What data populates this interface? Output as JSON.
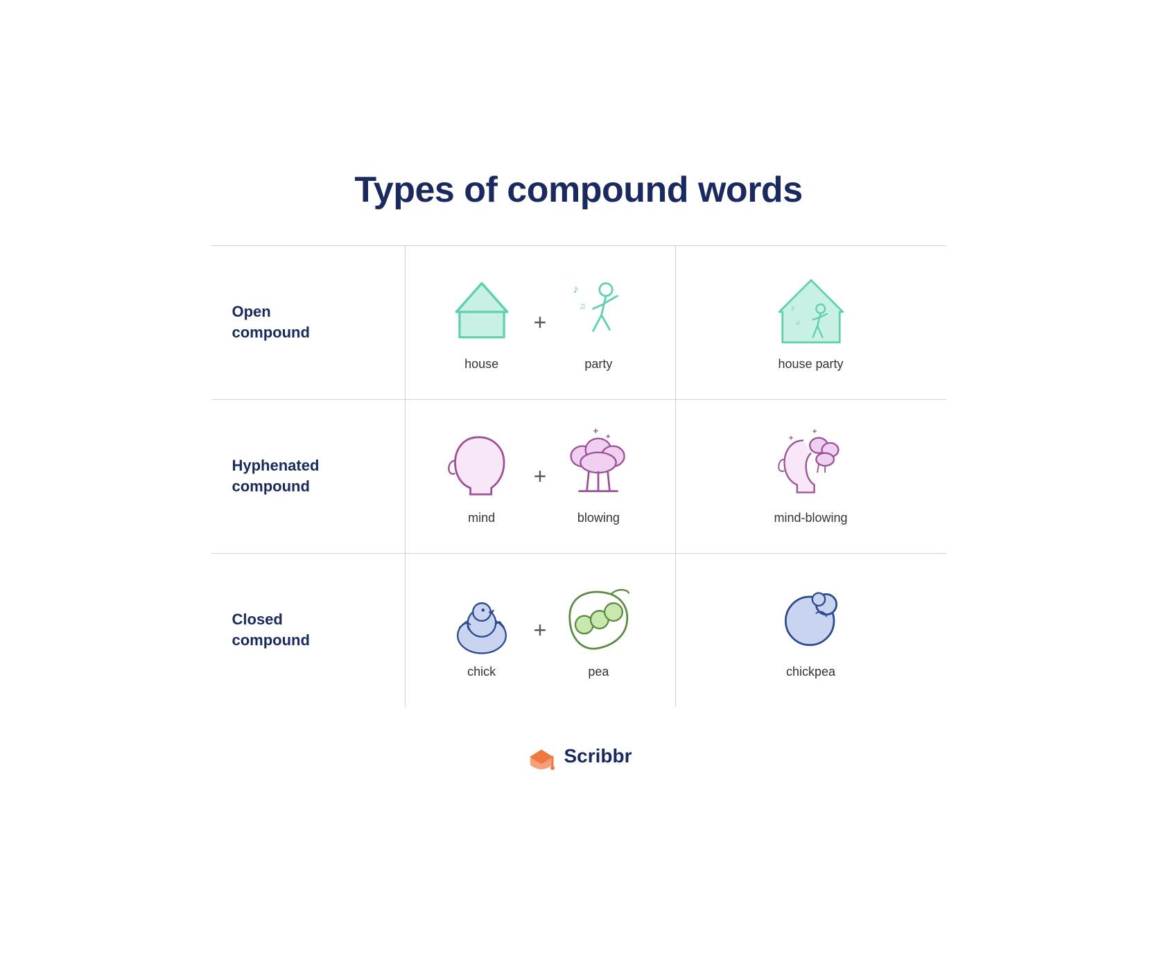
{
  "title": "Types of compound words",
  "rows": [
    {
      "label": "Open\ncompound",
      "part1_label": "house",
      "part2_label": "party",
      "result_label": "house party",
      "type": "open"
    },
    {
      "label": "Hyphenated\ncompound",
      "part1_label": "mind",
      "part2_label": "blowing",
      "result_label": "mind-blowing",
      "type": "hyphenated"
    },
    {
      "label": "Closed\ncompound",
      "part1_label": "chick",
      "part2_label": "pea",
      "result_label": "chickpea",
      "type": "closed"
    }
  ],
  "footer": {
    "brand": "Scribbr"
  },
  "colors": {
    "teal": "#5ecfb0",
    "teal_light": "#c8f0e4",
    "purple": "#9b4f96",
    "purple_light": "#e8c8e8",
    "navy": "#1a2a5e",
    "blue_light": "#c8d4e8",
    "orange": "#f07840"
  },
  "plus": "+",
  "icons": {
    "house": "house",
    "party_person": "party-person",
    "house_party": "house-party",
    "mind": "mind",
    "blowing": "blowing",
    "mind_blowing": "mind-blowing",
    "chick": "chick",
    "pea": "pea",
    "chickpea": "chickpea"
  }
}
